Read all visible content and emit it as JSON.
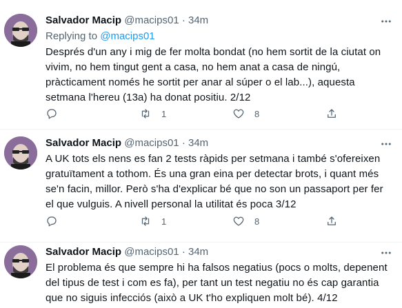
{
  "tweets": [
    {
      "name": "Salvador Macip",
      "handle": "@macips01",
      "dot": "·",
      "time": "34m",
      "replying_label": "Replying to",
      "replying_handle": "@macips01",
      "text": "Després d'un any i mig de fer molta bondat (no hem sortit de la ciutat on vivim, no hem tingut gent a casa, no hem anat a casa de ningú, pràcticament només he sortit per anar al súper o el lab...), aquesta setmana l'hereu (13a) ha donat positiu. 2/12",
      "replies": "",
      "retweets": "1",
      "likes": "8"
    },
    {
      "name": "Salvador Macip",
      "handle": "@macips01",
      "dot": "·",
      "time": "34m",
      "text": "A UK tots els nens es fan 2 tests ràpids per setmana i també s'ofereixen gratuïtament a tothom. És una gran eina per detectar brots, i quant més se'n facin, millor. Però s'ha d'explicar bé que no son un passaport per fer el que vulguis. A nivell personal la utilitat és poca 3/12",
      "replies": "",
      "retweets": "1",
      "likes": "8"
    },
    {
      "name": "Salvador Macip",
      "handle": "@macips01",
      "dot": "·",
      "time": "34m",
      "text": "El problema és que sempre hi ha falsos negatius (pocs o molts, depenent del tipus de test i com es fa), per tant un test negatiu no és cap garantia que no siguis infecciós (això a UK t'ho expliquen molt bé). 4/12"
    }
  ],
  "colors": {
    "link": "#1d9bf0",
    "secondary": "#536471",
    "text": "#0f1419",
    "avatar_bg": "#8b6d9c"
  },
  "icons": [
    "reply-icon",
    "retweet-icon",
    "like-icon",
    "share-icon",
    "more-icon"
  ]
}
